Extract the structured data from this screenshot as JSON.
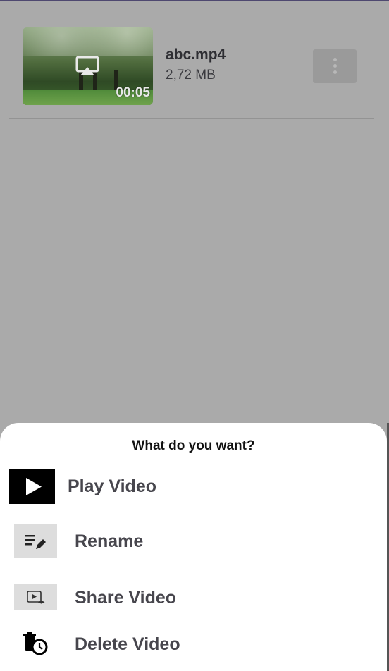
{
  "video": {
    "name": "abc.mp4",
    "size": "2,72 MB",
    "duration": "00:05"
  },
  "sheet": {
    "title": "What do you want?",
    "actions": [
      {
        "label": "Play Video",
        "icon": "play-icon"
      },
      {
        "label": "Rename",
        "icon": "rename-icon"
      },
      {
        "label": "Share Video",
        "icon": "share-video-icon"
      },
      {
        "label": "Delete Video",
        "icon": "delete-scheduled-icon"
      }
    ]
  },
  "colors": {
    "scrim": "#aaaaaa",
    "sheet_background": "#ffffff",
    "action_label": "#47464d",
    "top_bar": "#4e4870"
  }
}
